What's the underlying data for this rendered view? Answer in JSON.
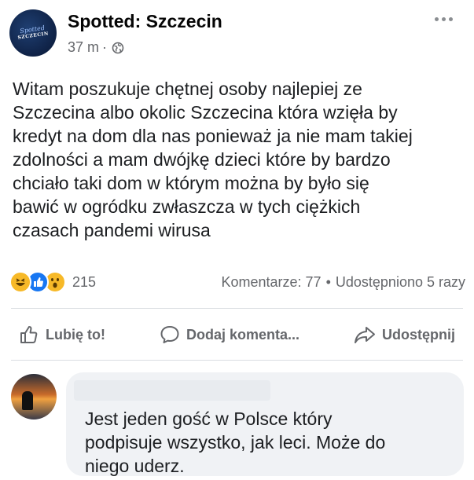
{
  "post": {
    "page_name": "Spotted: Szczecin",
    "time": "37 m",
    "separator": "·",
    "avatar_logo_text": "Spotted",
    "avatar_logo_sub": "SZCZECIN",
    "text": "Witam poszukuje chętnej osoby najlepiej ze\nSzczecina albo okolic Szczecina która wzięła by\nkredyt na dom dla nas ponieważ ja nie mam takiej\nzdolności a mam dwójkę dzieci które by bardzo\nchciało taki dom w którym można by było się\nbawić w ogródku zwłaszcza w tych ciężkich\nczasach pandemi wirusa"
  },
  "reactions": {
    "icons": [
      "haha",
      "like",
      "wow"
    ],
    "count": "215",
    "comments": "Komentarze: 77",
    "dot": "•",
    "shares": "Udostępniono 5 razy"
  },
  "actions": {
    "like_label": "Lubię to!",
    "comment_label": "Dodaj komenta...",
    "share_label": "Udostępnij"
  },
  "comment": {
    "text": "Jest jeden gość w Polsce który\npodpisuje wszystko, jak leci. Może do\nniego uderz."
  },
  "colors": {
    "like_blue": "#1877f2",
    "reaction_yellow": "#f7b928",
    "secondary_text": "#65676b",
    "bubble_bg": "#f0f2f5"
  }
}
